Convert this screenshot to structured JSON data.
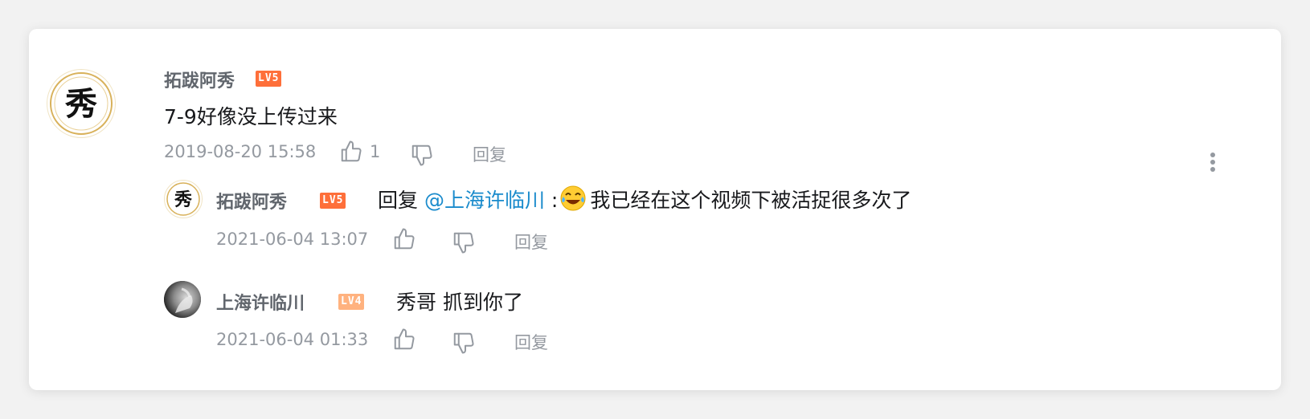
{
  "comment": {
    "username": "拓跋阿秀",
    "level": "LV5",
    "text": "7-9好像没上传过来",
    "time": "2019-08-20 15:58",
    "like_count": "1",
    "reply_label": "回复",
    "avatar_glyph": "秀"
  },
  "replies": [
    {
      "username": "拓跋阿秀",
      "level": "LV5",
      "reply_prefix": "回复 ",
      "mention": "@上海许临川",
      "separator": " :",
      "emoji": "laughing-tears-emoji",
      "text": "我已经在这个视频下被活捉很多次了",
      "time": "2021-06-04 13:07",
      "reply_label": "回复",
      "avatar_glyph": "秀"
    },
    {
      "username": "上海许临川",
      "level": "LV4",
      "text": "秀哥 抓到你了",
      "time": "2021-06-04 01:33",
      "reply_label": "回复"
    }
  ],
  "colors": {
    "lv5": "#fe6f3a",
    "lv4": "#ffb27f",
    "mention": "#1a8bcc",
    "meta": "#9499a0"
  },
  "icons": [
    "thumbs-up-icon",
    "thumbs-down-icon",
    "more-vertical-icon"
  ]
}
